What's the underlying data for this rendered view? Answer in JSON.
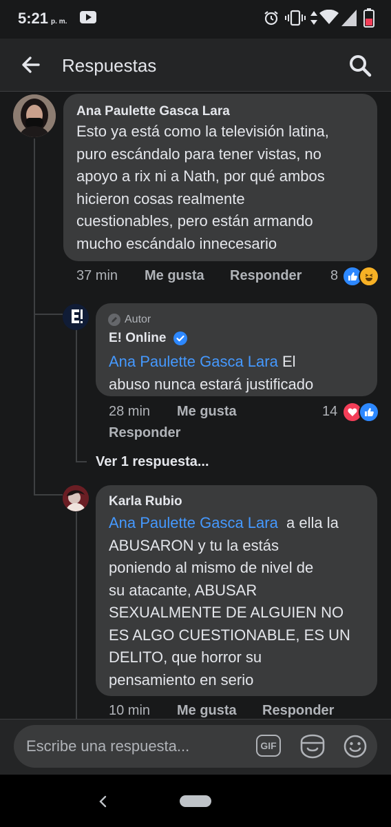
{
  "status": {
    "time": "5:21",
    "ampm": "p. m."
  },
  "header": {
    "title": "Respuestas"
  },
  "comments": {
    "c1": {
      "author": "Ana Paulette Gasca Lara",
      "lines": [
        "Esto ya está como la televisión latina,",
        "puro escándalo para tener vistas, no",
        "apoyo a rix ni a Nath, por qué ambos",
        "hicieron cosas realmente",
        "cuestionables, pero están armando",
        "mucho escándalo innecesario"
      ],
      "time": "37 min",
      "like": "Me gusta",
      "reply": "Responder",
      "reaction_count": "8"
    },
    "c2": {
      "badge": "Autor",
      "author": "E! Online",
      "mention": "Ana Paulette Gasca Lara",
      "line1_rest": " El",
      "line2": "abuso nunca estará justificado",
      "time": "28 min",
      "like": "Me gusta",
      "reply": "Responder",
      "reaction_count": "14",
      "view_replies": "Ver 1 respuesta..."
    },
    "c3": {
      "author": "Karla Rubio",
      "mention": "Ana Paulette Gasca Lara",
      "line1_rest": "  a ella la",
      "lines": [
        "ABUSARON y tu la estás",
        "poniendo al mismo de nivel de",
        "su atacante, ABUSAR",
        "SEXUALMENTE DE ALGUIEN NO",
        "ES ALGO CUESTIONABLE, ES UN",
        "DELITO, que horror su",
        "pensamiento en serio"
      ],
      "time": "10 min",
      "like": "Me gusta",
      "reply": "Responder"
    }
  },
  "composer": {
    "placeholder": "Escribe una respuesta...",
    "gif_label": "GIF"
  },
  "colors": {
    "background": "#18191a",
    "bubble": "#3a3b3c",
    "mention": "#4599ff",
    "verified": "#2d88ff",
    "love": "#f33e58",
    "like": "#2d88ff",
    "haha": "#f7b125"
  }
}
